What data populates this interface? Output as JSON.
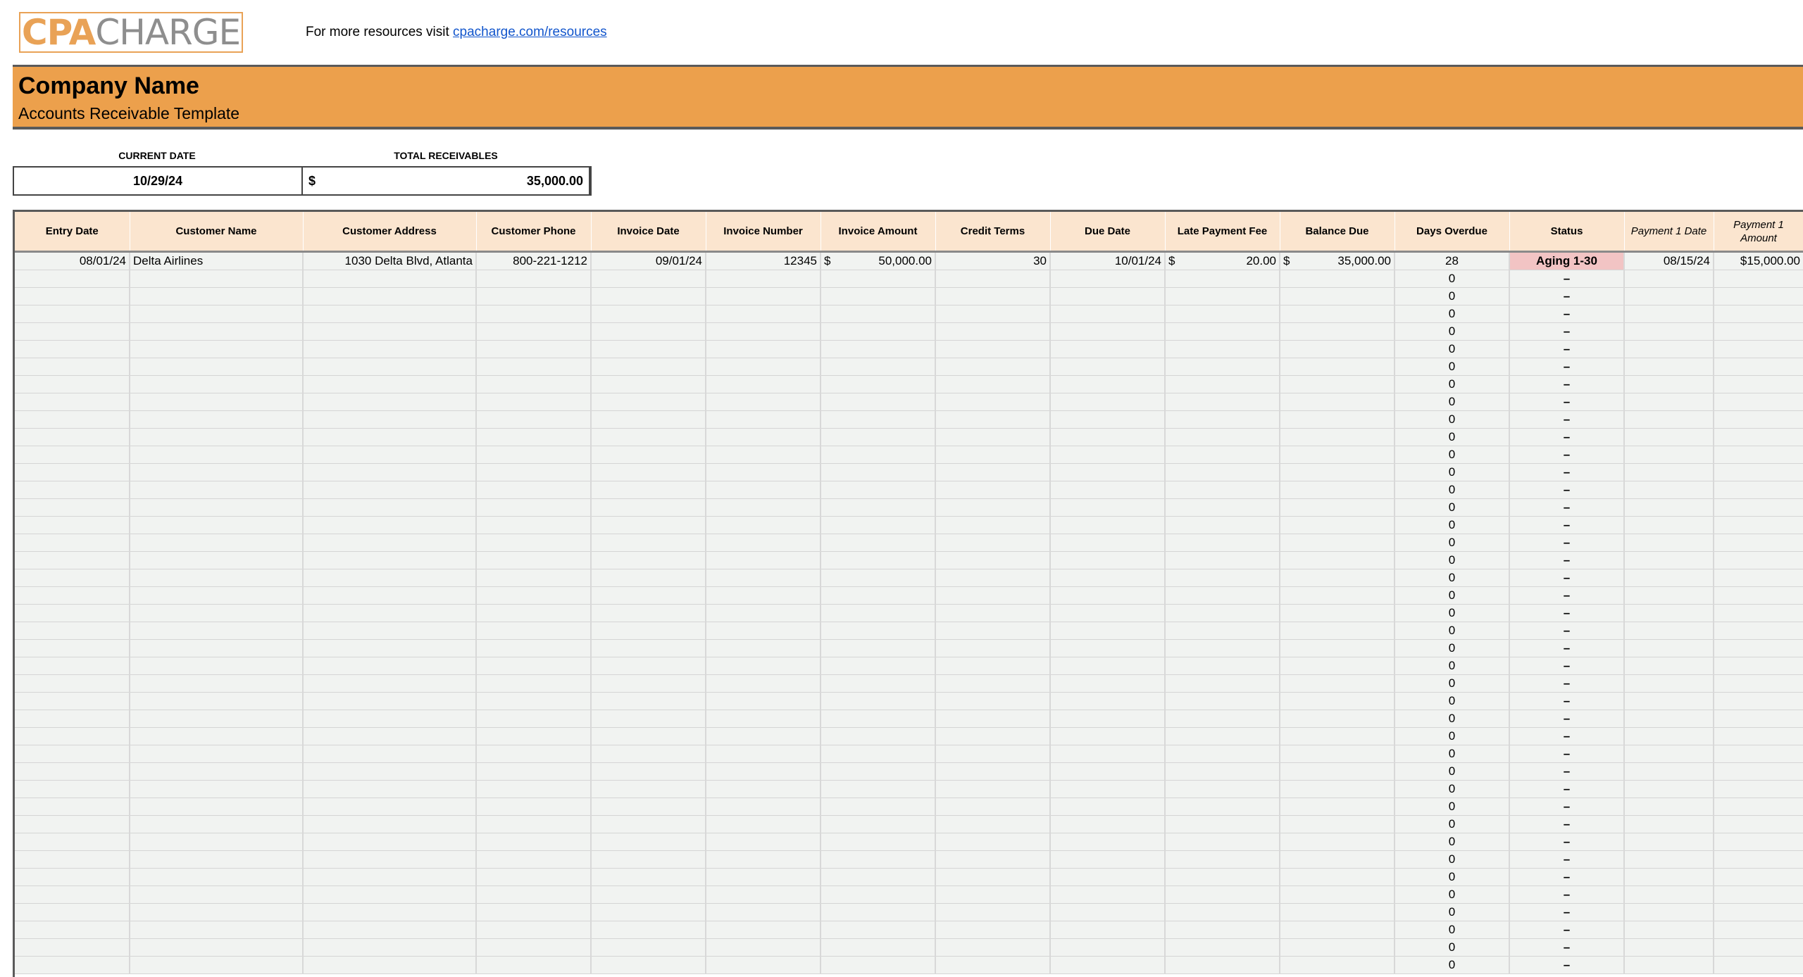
{
  "logo": {
    "part1": "CPA",
    "part2": "CHARGE"
  },
  "resources": {
    "text": "For more resources visit ",
    "link": "cpacharge.com/resources"
  },
  "banner": {
    "company": "Company Name",
    "subtitle": "Accounts Receivable Template"
  },
  "summary": {
    "current_date_label": "CURRENT DATE",
    "current_date": "10/29/24",
    "total_label": "TOTAL RECEIVABLES",
    "total_currency": "$",
    "total_value": "35,000.00"
  },
  "columns": [
    "Entry Date",
    "Customer Name",
    "Customer Address",
    "Customer Phone",
    "Invoice Date",
    "Invoice Number",
    "Invoice Amount",
    "Credit Terms",
    "Due Date",
    "Late Payment Fee",
    "Balance Due",
    "Days Overdue",
    "Status",
    "Payment 1 Date",
    "Payment 1 Amount"
  ],
  "rows": [
    {
      "entry_date": "08/01/24",
      "customer_name": "Delta Airlines",
      "customer_address": "1030 Delta Blvd, Atlanta",
      "customer_phone": "800-221-1212",
      "invoice_date": "09/01/24",
      "invoice_number": "12345",
      "invoice_amount_currency": "$",
      "invoice_amount": "50,000.00",
      "credit_terms": "30",
      "due_date": "10/01/24",
      "late_fee_currency": "$",
      "late_fee": "20.00",
      "balance_currency": "$",
      "balance_due": "35,000.00",
      "days_overdue": "28",
      "status": "Aging 1-30",
      "payment1_date": "08/15/24",
      "payment1_amount": "$15,000.00"
    }
  ],
  "empty_rows": {
    "days_overdue": "0",
    "status": "–"
  },
  "colors": {
    "accent": "#eca04c",
    "header_bg": "#fbe5cf",
    "cell_bg": "#f1f3f1",
    "aging_bg": "#f2c4c4",
    "link": "#1155cc"
  }
}
